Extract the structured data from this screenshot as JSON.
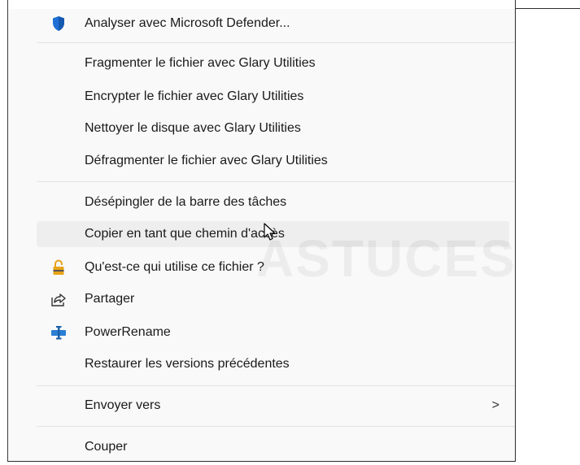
{
  "menu": {
    "defender": {
      "label": "Analyser avec Microsoft Defender...",
      "icon": "defender-shield-icon",
      "color": "#1f6fd6"
    },
    "glary": [
      {
        "label": "Fragmenter le fichier avec Glary Utilities"
      },
      {
        "label": "Encrypter le fichier avec Glary Utilities"
      },
      {
        "label": "Nettoyer le disque avec Glary Utilities"
      },
      {
        "label": "Défragmenter le fichier avec Glary Utilities"
      }
    ],
    "unpin": {
      "label": "Désépingler de la barre des tâches"
    },
    "copy_path": {
      "label": "Copier en tant que chemin d'accès"
    },
    "who_uses": {
      "label": "Qu'est-ce qui utilise ce fichier ?",
      "icon": "padlock-icon",
      "color": "#e8a317"
    },
    "share": {
      "label": "Partager",
      "icon": "share-icon"
    },
    "power_rename": {
      "label": "PowerRename",
      "icon": "powerrename-icon",
      "color": "#2b7fd4"
    },
    "restore": {
      "label": "Restaurer les versions précédentes"
    },
    "send_to": {
      "label": "Envoyer vers",
      "chevron": ">"
    },
    "cut": {
      "label": "Couper"
    }
  },
  "watermark": {
    "text": "ASTUCES"
  },
  "hover_color": "#eeeeee",
  "menu_background": "#f9f9f9"
}
